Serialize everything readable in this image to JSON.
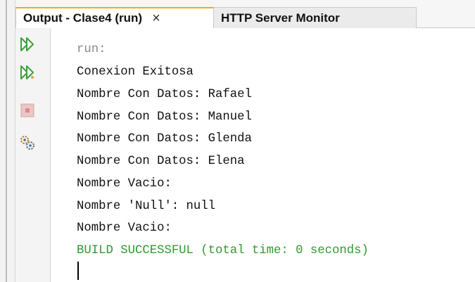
{
  "tabs": [
    {
      "label": "Output - Clase4 (run)",
      "close": "×",
      "active": true
    },
    {
      "label": "HTTP Server Monitor",
      "active": false
    }
  ],
  "toolbar": {
    "buttons": [
      {
        "icon": "rerun-icon",
        "color": "#3aa03a"
      },
      {
        "icon": "rerun-with-options-icon",
        "color": "#3aa03a"
      },
      {
        "icon": "stop-icon",
        "color": "#d98c8c"
      },
      {
        "icon": "settings-icon",
        "color": "#c58a2b"
      }
    ]
  },
  "console": {
    "lines": [
      {
        "text": "run:",
        "style": "gray"
      },
      {
        "text": "Conexion Exitosa",
        "style": "normal"
      },
      {
        "text": "Nombre Con Datos: Rafael",
        "style": "normal"
      },
      {
        "text": "Nombre Con Datos: Manuel",
        "style": "normal"
      },
      {
        "text": "Nombre Con Datos: Glenda",
        "style": "normal"
      },
      {
        "text": "Nombre Con Datos: Elena",
        "style": "normal"
      },
      {
        "text": "Nombre Vacio:",
        "style": "normal"
      },
      {
        "text": "Nombre 'Null': null",
        "style": "normal"
      },
      {
        "text": "Nombre Vacio:",
        "style": "normal"
      },
      {
        "text": "BUILD SUCCESSFUL (total time: 0 seconds)",
        "style": "green"
      }
    ]
  },
  "colors": {
    "accent_tab": "#f0a91e",
    "success_text": "#2f9a2f",
    "muted_text": "#8a8a8a"
  }
}
